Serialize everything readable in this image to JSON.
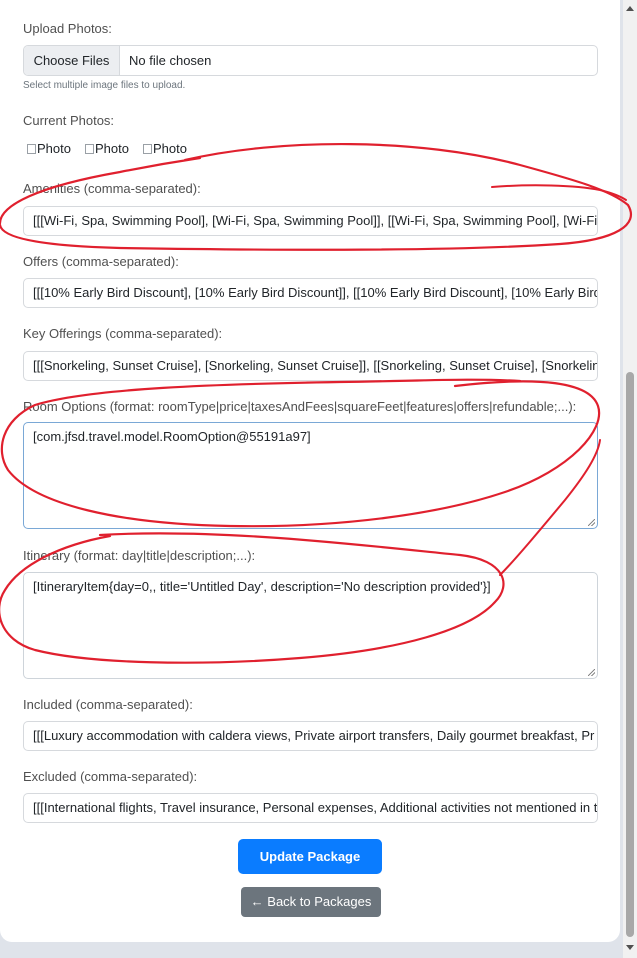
{
  "upload": {
    "label": "Upload Photos:",
    "button_label": "Choose Files",
    "status": "No file chosen",
    "help": "Select multiple image files to upload."
  },
  "current_photos": {
    "label": "Current Photos:",
    "photos": [
      "Photo",
      "Photo",
      "Photo"
    ]
  },
  "amenities": {
    "label": "Amenities (comma-separated):",
    "value": "[[[Wi-Fi, Spa, Swimming Pool], [Wi-Fi, Spa, Swimming Pool]], [[Wi-Fi, Spa, Swimming Pool], [Wi-Fi"
  },
  "offers": {
    "label": "Offers (comma-separated):",
    "value": "[[[10% Early Bird Discount], [10% Early Bird Discount]], [[10% Early Bird Discount], [10% Early Bird"
  },
  "key_offerings": {
    "label": "Key Offerings (comma-separated):",
    "value": "[[[Snorkeling, Sunset Cruise], [Snorkeling, Sunset Cruise]], [[Snorkeling, Sunset Cruise], [Snorkeling"
  },
  "room_options": {
    "label": "Room Options (format: roomType|price|taxesAndFees|squareFeet|features|offers|refundable;...):",
    "value": "[com.jfsd.travel.model.RoomOption@55191a97]"
  },
  "itinerary": {
    "label": "Itinerary (format: day|title|description;...):",
    "value": "[ItineraryItem{day=0,, title='Untitled Day', description='No description provided'}]"
  },
  "included": {
    "label": "Included (comma-separated):",
    "value": "[[[Luxury accommodation with caldera views, Private airport transfers, Daily gourmet breakfast, Pr"
  },
  "excluded": {
    "label": "Excluded (comma-separated):",
    "value": "[[[International flights, Travel insurance, Personal expenses, Additional activities not mentioned in t"
  },
  "actions": {
    "update_label": "Update Package",
    "back_label": "← Back to Packages"
  },
  "colors": {
    "primary": "#0a7cff",
    "secondary": "#6c757d",
    "annotation": "#e0202e"
  }
}
